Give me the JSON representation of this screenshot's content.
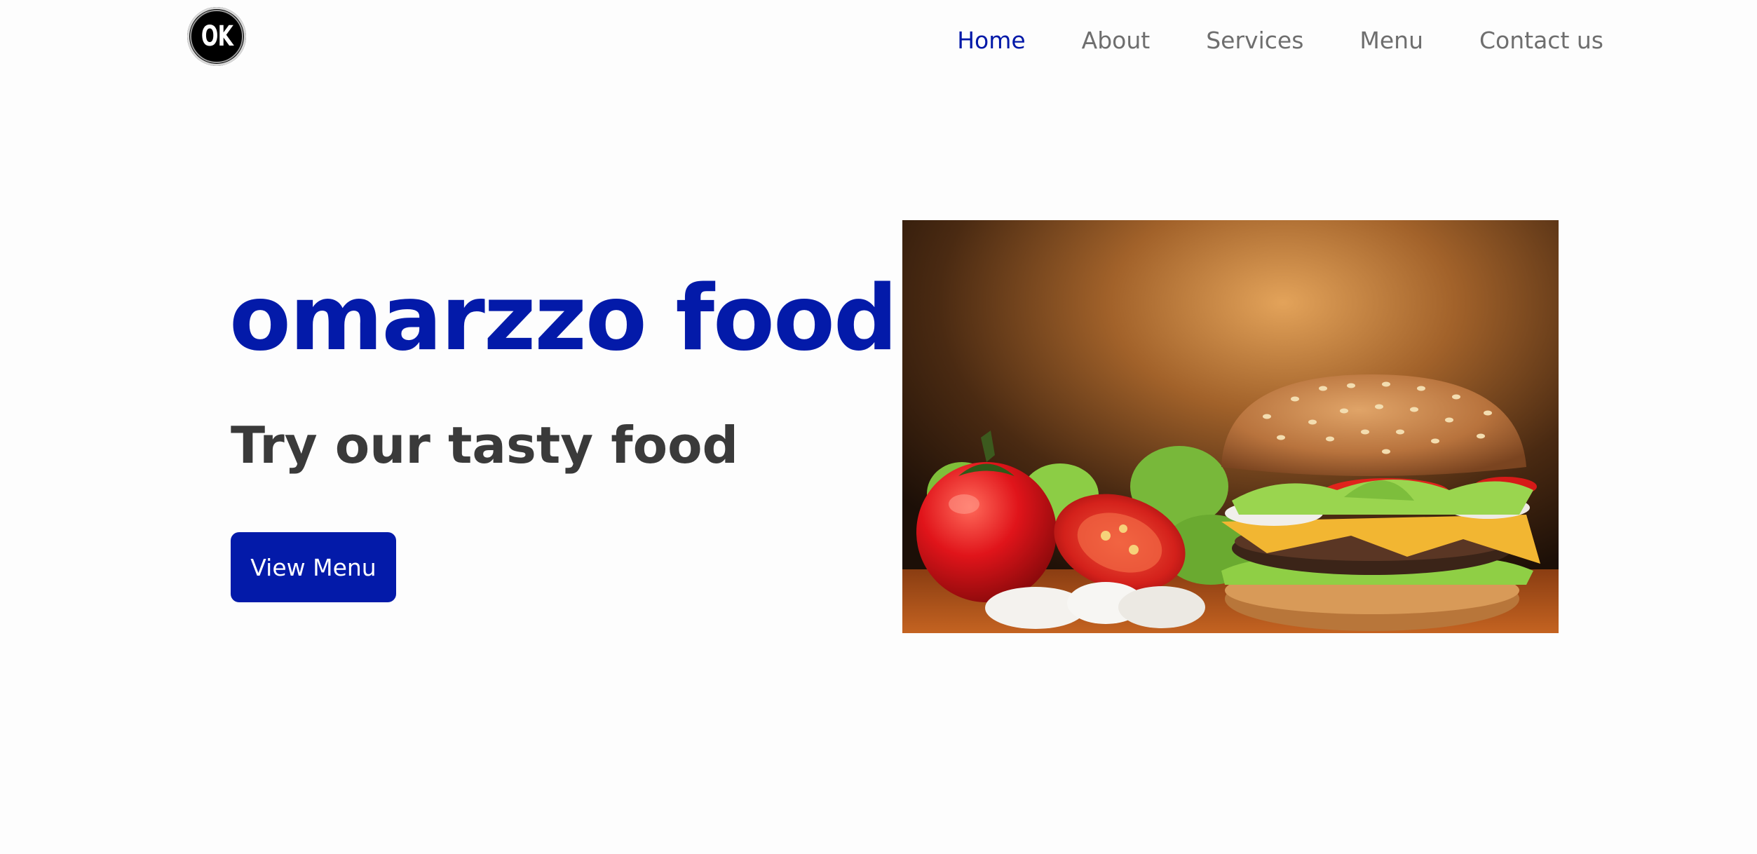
{
  "header": {
    "logo_text": "OK",
    "nav": [
      {
        "label": "Home",
        "active": true
      },
      {
        "label": "About",
        "active": false
      },
      {
        "label": "Services",
        "active": false
      },
      {
        "label": "Menu",
        "active": false
      },
      {
        "label": "Contact us",
        "active": false
      }
    ]
  },
  "hero": {
    "title": "omarzzo food",
    "subtitle": "Try our tasty food",
    "cta_label": "View Menu"
  },
  "colors": {
    "brand": "#031aa9",
    "nav_inactive": "#6e6e6e",
    "subtitle": "#3a3a3a",
    "background": "#fdfdfd"
  },
  "icons": {
    "logo": "ok-logo-icon",
    "hero_image": "burger-image"
  }
}
